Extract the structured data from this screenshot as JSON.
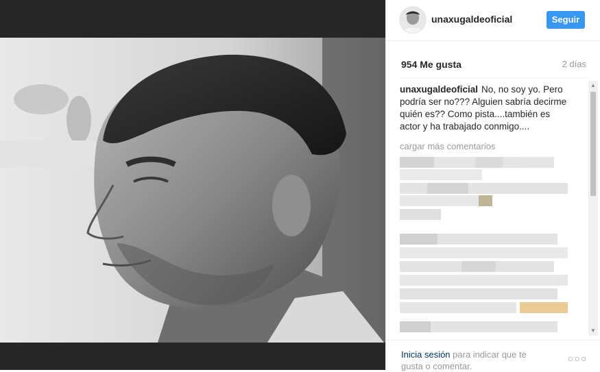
{
  "post": {
    "username": "unaxugaldeoficial",
    "follow_label": "Seguir",
    "likes": "954 Me gusta",
    "age": "2 días",
    "caption_user": "unaxugaldeoficial",
    "caption_text": "No, no soy yo. Pero podría ser no??? Alguien sabría decirme quién es?? Como pista....también es actor y ha trabajado conmigo....",
    "load_more": "cargar más comentarios"
  },
  "footer": {
    "login_link": "Inicia sesión",
    "login_rest": " para indicar que te gusta o comentar.",
    "more_icon": "ellipsis-icon"
  },
  "colors": {
    "accent": "#3897f0",
    "muted": "#999999",
    "link": "#003569",
    "media_bg": "#262626"
  }
}
